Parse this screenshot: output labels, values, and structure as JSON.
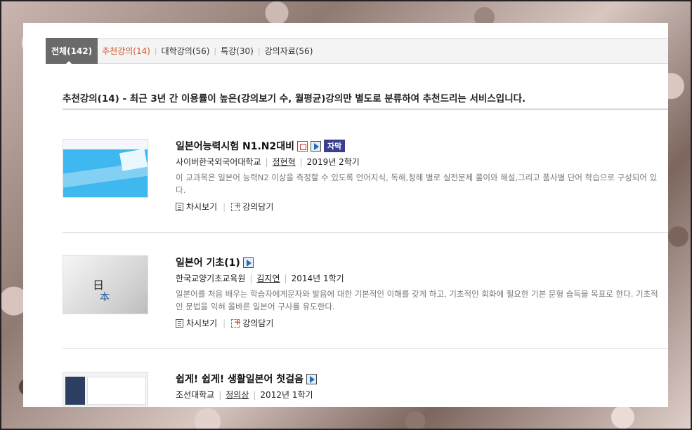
{
  "tabs": {
    "active": "전체(142)",
    "items": [
      {
        "label": "추천강의(14)",
        "hot": true
      },
      {
        "label": "대학강의(56)",
        "hot": false
      },
      {
        "label": "특강(30)",
        "hot": false
      },
      {
        "label": "강의자료(56)",
        "hot": false
      }
    ]
  },
  "description": "추천강의(14) - 최근 3년 간 이용률이 높은(강의보기 수, 월평균)강의만 별도로 분류하여 추천드리는 서비스입니다.",
  "actions": {
    "chapters": "차시보기",
    "cart": "강의담기"
  },
  "courses": [
    {
      "title": "일본어능력시험 N1.N2대비",
      "badge": "자막",
      "university": "사이버한국외국어대학교",
      "professor": "정현혁",
      "term": "2019년 2학기",
      "summary": "이 교과목은 일본어 능력N2 이상을 측정할 수 있도록 언어지식, 독해,청해 별로 실전문제 풀이와 해설,그리고 품사별 단어 학습으로 구성되어 있다."
    },
    {
      "title": "일본어 기초(1)",
      "university": "한국교양기초교육원",
      "professor": "김지연",
      "term": "2014년 1학기",
      "summary": "일본어를 처음 배우는 학습자에게문자와 발음에 대한 기본적인 이해를 갖게 하고, 기초적인 회화에 필요한 기본 문형 습득을 목표로 한다. 기초적인 문법을 익혀 올바른 일본어 구사를 유도한다."
    },
    {
      "title": "쉽게! 쉽게! 생활일본어 첫걸음",
      "university": "조선대학교",
      "professor": "정의상",
      "term": "2012년 1학기"
    }
  ]
}
